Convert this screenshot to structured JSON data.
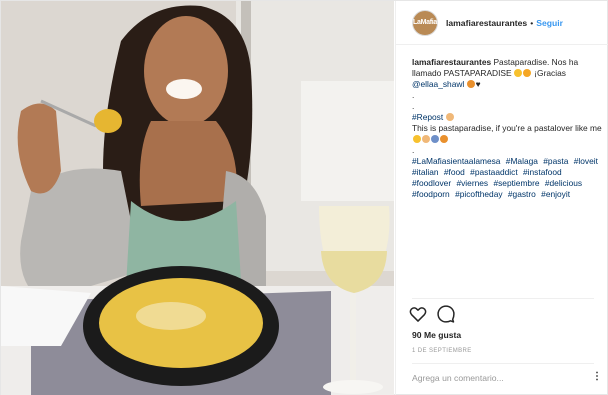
{
  "post": {
    "username": "lamafiarestaurantes",
    "follow_label": "Seguir",
    "separator": "•",
    "avatar_text": "LaMafia",
    "caption_user": "lamafiarestaurantes",
    "caption_lines": [
      "Pastaparadise. Nos ha llamado PASTAPARADISE",
      "¡Gracias"
    ],
    "mention": "@ellaa_shawl",
    "dots": [
      ".",
      ".",
      "."
    ],
    "repost_tag": "#Repost",
    "repost_text": "This is pastaparadise, if you're a pastalover like me",
    "period": ".",
    "hashtags": [
      "#LaMafiasientaalamesa",
      "#Malaga",
      "#pasta",
      "#loveit",
      "#italian",
      "#food",
      "#pastaaddict",
      "#instafood",
      "#foodlover",
      "#viernes",
      "#septiembre",
      "#delicious",
      "#foodporn",
      "#picoftheday",
      "#gastro",
      "#enjoyit"
    ],
    "likes": "90 Me gusta",
    "date": "1 DE SEPTIEMBRE",
    "comment_placeholder": "Agrega un comentario...",
    "more_label": "⋮"
  },
  "icons": {
    "like": "heart-outline-icon",
    "comment": "comment-bubble-icon",
    "options": "more-vertical-icon"
  },
  "colors": {
    "link": "#003569",
    "follow": "#3897f0",
    "secondary_text": "#999999"
  }
}
